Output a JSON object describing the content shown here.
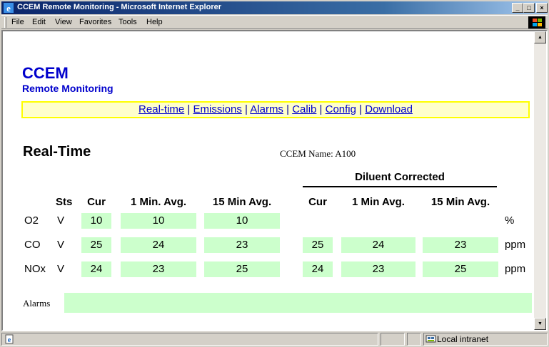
{
  "window": {
    "title": "CCEM Remote Monitoring - Microsoft Internet Explorer",
    "minimize": "_",
    "maximize": "□",
    "close": "×"
  },
  "menu": [
    "File",
    "Edit",
    "View",
    "Favorites",
    "Tools",
    "Help"
  ],
  "logo": {
    "line1": "CCEM",
    "line2": "Remote Monitoring"
  },
  "nav": [
    "Real-time",
    "Emissions",
    "Alarms",
    "Calib",
    "Config",
    "Download"
  ],
  "nav_sep": "|",
  "page": {
    "heading": "Real-Time",
    "ccem_name": "CCEM Name: A100",
    "diluent_corrected": "Diluent Corrected"
  },
  "columns": {
    "sts": "Sts",
    "cur": "Cur",
    "one_min": "1 Min. Avg.",
    "fifteen_min": "15 Min Avg.",
    "dil_cur": "Cur",
    "dil_one_min": "1 Min Avg.",
    "dil_fifteen_min": "15 Min Avg."
  },
  "rows": [
    {
      "gas": "O2",
      "sts": "V",
      "cur": "10",
      "one_min": "10",
      "fifteen_min": "10",
      "dil_cur": "",
      "dil_one_min": "",
      "dil_fifteen_min": "",
      "unit": "%"
    },
    {
      "gas": "CO",
      "sts": "V",
      "cur": "25",
      "one_min": "24",
      "fifteen_min": "23",
      "dil_cur": "25",
      "dil_one_min": "24",
      "dil_fifteen_min": "23",
      "unit": "ppm"
    },
    {
      "gas": "NOx",
      "sts": "V",
      "cur": "24",
      "one_min": "23",
      "fifteen_min": "25",
      "dil_cur": "24",
      "dil_one_min": "23",
      "dil_fifteen_min": "25",
      "unit": "ppm"
    }
  ],
  "alarms": {
    "label": "Alarms",
    "value": ""
  },
  "status": {
    "zone": "Local intranet"
  },
  "colors": {
    "cell_bg": "#ccffcc",
    "nav_bg": "#ffffcc",
    "nav_border": "#ffff00",
    "logo": "#0000cc",
    "title_bar": "#0a246a"
  },
  "icons": [
    "ie-icon",
    "windows-logo-icon",
    "scroll-up-icon",
    "scroll-down-icon",
    "page-icon",
    "intranet-icon"
  ]
}
